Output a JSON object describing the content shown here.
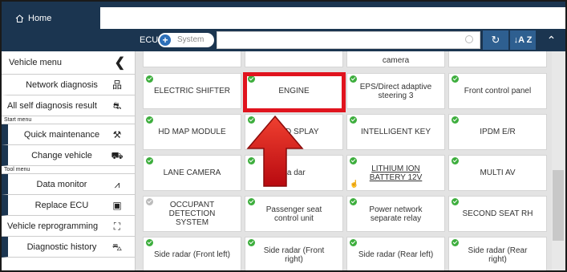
{
  "header": {
    "home_label": "Home"
  },
  "toolbar": {
    "ecu_label": "ECU",
    "toggle_symbol": "+",
    "toggle_label": "System",
    "search_placeholder": "",
    "refresh_glyph": "↻",
    "sort_glyph": "↓A Z",
    "collapse_glyph": "⌃"
  },
  "sidebar": {
    "title": "Vehicle menu",
    "back_glyph": "❮",
    "items": [
      {
        "label": "Network diagnosis",
        "icon": "network-icon"
      },
      {
        "label": "All self diagnosis result",
        "icon": "car-search-icon"
      }
    ],
    "start_menu_label": "Start menu",
    "start_items": [
      {
        "label": "Quick maintenance",
        "icon": "wrench-icon"
      },
      {
        "label": "Change vehicle",
        "icon": "car-icon"
      }
    ],
    "tool_menu_label": "Tool menu",
    "tool_items": [
      {
        "label": "Data monitor",
        "icon": "monitor-icon"
      },
      {
        "label": "Replace ECU",
        "icon": "chip-icon"
      },
      {
        "label": "Vehicle reprogramming",
        "icon": "reprogram-icon"
      },
      {
        "label": "Diagnostic history",
        "icon": "history-icon"
      }
    ]
  },
  "grid": {
    "partial_top": [
      "camera"
    ],
    "rows": [
      [
        "ELECTRIC SHIFTER",
        "ENGINE",
        "EPS/Direct adaptive steering 3",
        "Front control panel"
      ],
      [
        "HD MAP MODULE",
        "HEAD SPLAY",
        "INTELLIGENT KEY",
        "IPDM E/R"
      ],
      [
        "LANE CAMERA",
        "La dar",
        "LITHIUM ION BATTERY 12V",
        "MULTI AV"
      ],
      [
        "OCCUPANT DETECTION SYSTEM",
        "Passenger seat control unit",
        "Power network separate relay",
        "SECOND SEAT RH"
      ],
      [
        "Side radar (Front left)",
        "Side radar (Front right)",
        "Side radar (Rear left)",
        "Side radar (Rear right)"
      ]
    ]
  },
  "colors": {
    "accent": "#1b3550",
    "highlight": "#e0141e",
    "check": "#3dae3d"
  }
}
